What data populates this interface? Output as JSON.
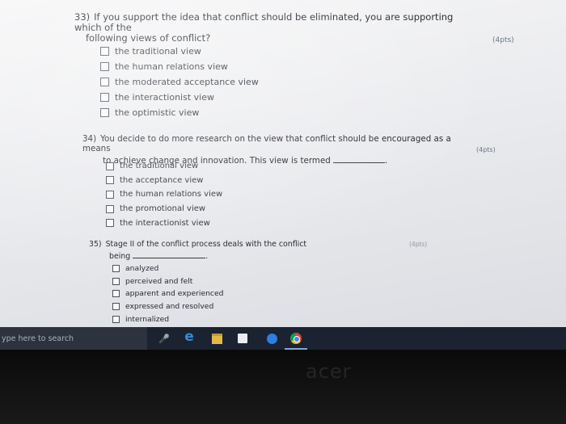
{
  "questions": [
    {
      "number": "33)",
      "line1": "If you support the idea that conflict should be eliminated, you are supporting which of the",
      "line2": "following views of conflict?",
      "points": "(4pts)",
      "options": [
        "the traditional view",
        "the human relations view",
        "the moderated acceptance view",
        "the interactionist view",
        "the optimistic view"
      ]
    },
    {
      "number": "34)",
      "line1": "You decide to do more research on the view that conflict should be encouraged as a means",
      "line2": "to achieve change and innovation.  This view is termed",
      "line2_end": ".",
      "points": "(4pts)",
      "options": [
        "the traditional view",
        "the acceptance view",
        "the human relations view",
        "the promotional view",
        "the interactionist view"
      ]
    },
    {
      "number": "35)",
      "line1": "Stage II of the conflict process deals with the conflict",
      "line2": "being",
      "line2_end": ".",
      "points": "(4pts)",
      "options": [
        "analyzed",
        "perceived and felt",
        "apparent and experienced",
        "expressed and resolved",
        "internalized"
      ]
    }
  ],
  "taskbar": {
    "search_placeholder": "ype here to search",
    "icons": [
      "microphone-icon",
      "edge-icon",
      "file-explorer-icon",
      "store-icon",
      "groove-music-icon",
      "chrome-icon"
    ]
  },
  "device": {
    "brand": "acer"
  }
}
